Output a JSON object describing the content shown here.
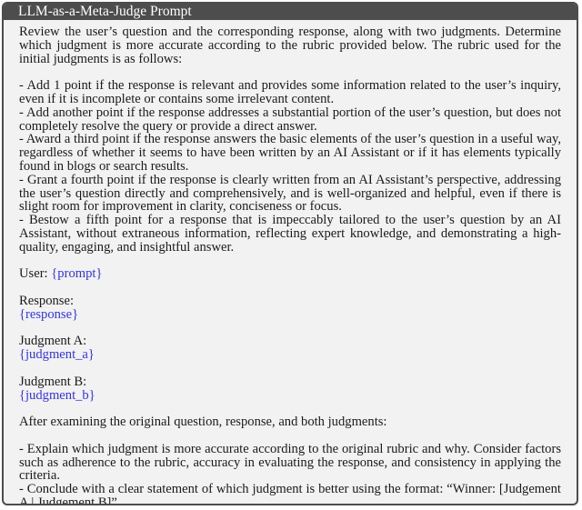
{
  "title": "LLM-as-a-Meta-Judge Prompt",
  "intro": "Review the user’s question and the corresponding response, along with two judgments. Determine which judgment is more accurate according to the rubric provided below.  The rubric used for the initial judgments is as follows:",
  "rubric": [
    "- Add 1 point if the response is relevant and provides some information related to the user’s inquiry, even if it is incomplete or contains some irrelevant content.",
    "- Add another point if the response addresses a substantial portion of the user’s question, but does not completely resolve the query or provide a direct answer.",
    "- Award a third point if the response answers the basic elements of the user’s question in a useful way, regardless of whether it seems to have been written by an AI Assistant or if it has elements typically found in blogs or search results.",
    "- Grant a fourth point if the response is clearly written from an AI Assistant’s perspective, addressing the user’s question directly and comprehensively, and is well-organized and helpful, even if there is slight room for improvement in clarity, conciseness or focus.",
    "- Bestow a fifth point for a response that is impeccably tailored to the user’s question by an AI Assistant, without extraneous information, reflecting expert knowledge, and demonstrating a high-quality, engaging, and insightful answer."
  ],
  "user_label": "User:",
  "user_placeholder": "{prompt}",
  "response_label": "Response:",
  "response_placeholder": "{response}",
  "judgment_a_label": "Judgment A:",
  "judgment_a_placeholder": "{judgment_a}",
  "judgment_b_label": "Judgment B:",
  "judgment_b_placeholder": "{judgment_b}",
  "after_text": "After examining the original question, response, and both judgments:",
  "instructions": [
    "- Explain which judgment is more accurate according to the original rubric and why. Consider factors such as adherence to the rubric, accuracy in evaluating the response, and consistency in applying the criteria.",
    "- Conclude with a clear statement of which judgment is better using the format: “Winner: [Judgement A | Judgement B]”"
  ],
  "colors": {
    "header_bg": "#4d4d4d",
    "box_bg": "#f2f2f2",
    "placeholder": "#3333e6"
  }
}
